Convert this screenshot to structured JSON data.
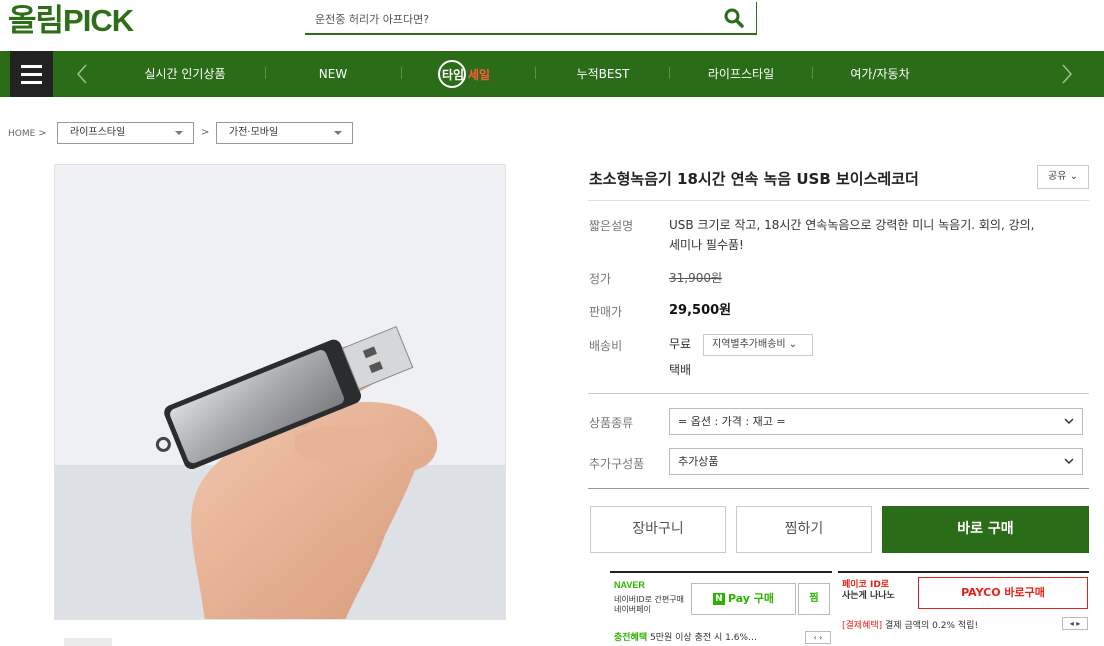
{
  "header": {
    "logo": "올림PICK",
    "search_placeholder": "운전중 허리가 아프다면?"
  },
  "nav": {
    "items": [
      "실시간 인기상품",
      "NEW",
      "누적BEST",
      "라이프스타일",
      "여가/자동차"
    ],
    "timesale": {
      "part1": "타임",
      "part2": "세일"
    }
  },
  "breadcrumb": {
    "home": "HOME",
    "sep": ">",
    "level1": "라이프스타일",
    "level2": "가전·모바일"
  },
  "product": {
    "title": "초소형녹음기 18시간 연속 녹음 USB 보이스레코더",
    "share_label": "공유",
    "desc_label": "짧은설명",
    "desc_line1": "USB 크기로 작고, 18시간 연속녹음으로 강력한 미니 녹음기. 회의, 강의,",
    "desc_line2": "세미나 필수품!",
    "list_price_label": "정가",
    "list_price": "31,900원",
    "sale_price_label": "판매가",
    "sale_price": "29,500원",
    "shipping_label": "배송비",
    "shipping_value": "무료",
    "shipping_option": "지역별추가배송비",
    "shipping_method": "택배",
    "option_label": "상품종류",
    "option_value": "= 옵션 : 가격 : 재고 =",
    "addon_label": "추가구성품",
    "addon_value": "추가상품"
  },
  "actions": {
    "cart": "장바구니",
    "wish": "찜하기",
    "buy": "바로 구매"
  },
  "naverpay": {
    "logo": "NAVER",
    "sub": "네이버ID로 간편구매 네이버페이",
    "button": "Pay 구매",
    "button_badge": "N",
    "zzim": "찜",
    "benefit_label": "충전혜택",
    "benefit_text": "5만원 이상 충전 시 1.6%…",
    "arrows": "‹ ›"
  },
  "payco": {
    "logo_line1": "페이코 ID로",
    "logo_line2": "사는게 나나노",
    "button": "PAYCO 바로구매",
    "benefit_label": "[결제혜택]",
    "benefit_text": "결제 금액의 0.2% 적립!",
    "arrows": "◂ ▸"
  },
  "colors": {
    "brand_green": "#2a6c17",
    "naver_green": "#2db400",
    "payco_red": "#e2231a"
  }
}
